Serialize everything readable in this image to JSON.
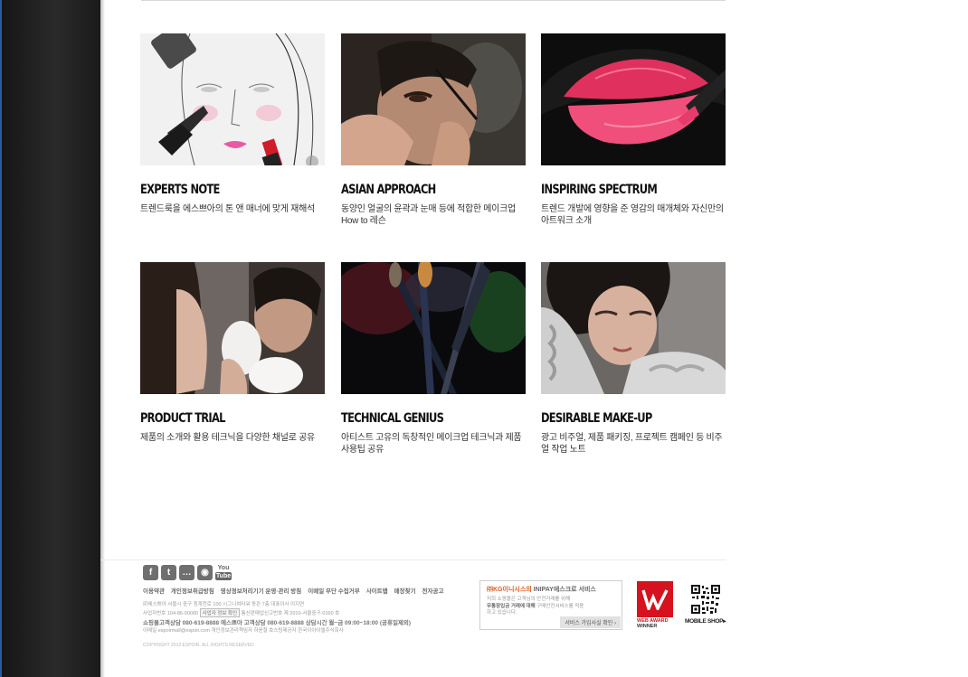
{
  "cards": [
    {
      "title": "EXPERTS NOTE",
      "desc": "트렌드룩을 에스쁘아의 톤 앤 매너에 맞게 재해석"
    },
    {
      "title": "ASIAN APPROACH",
      "desc": "동양인 얼굴의 윤곽과 눈매 등에 적합한 메이크업 How to 레슨"
    },
    {
      "title": "INSPIRING SPECTRUM",
      "desc": "트렌드 개발에 영향을 준 영감의 매개체와 자신만의 아트워크 소개"
    },
    {
      "title": "PRODUCT TRIAL",
      "desc": "제품의 소개와 활용 테크닉을 다양한 채널로 공유"
    },
    {
      "title": "TECHNICAL GENIUS",
      "desc": "아티스트 고유의 독창적인 메이크업 테크닉과 제품 사용팁 공유"
    },
    {
      "title": "DESIRABLE MAKE-UP",
      "desc": "광고 비주얼, 제품 패키징, 프로젝트 캠페인 등 비주얼 작업 노트"
    }
  ],
  "footer": {
    "social": {
      "facebook": "f",
      "twitter": "t",
      "talk": "…",
      "instagram": "◉",
      "youtube_top": "You",
      "youtube_bottom": "Tube"
    },
    "links": [
      "이용약관",
      "개인정보취급방침",
      "영상정보처리기기 운영·관리 방침",
      "이메일 무단 수집거부",
      "사이트맵",
      "매장찾기",
      "전자공고"
    ],
    "info1": "㈜에스쁘아    서울시 중구 청계천로 100 시그니쳐타워 동관 7층    대표이사 이지연",
    "info2a": "사업자번호 104-86-00000",
    "info2_btn": "사업자 정보 확인",
    "info2b": "통신판매업신고번호 제 2010-서울중구-0160 호",
    "info3": "쇼핑몰고객상담 080-619-8888  에스쁘아 고객상담 080-619-8888  상담시간 월~금 09:00~18:00 (공휴일제외)",
    "info4": "이메일 espoirmall@espoir.com    개인정보관리책임자 하윤철    호스팅제공자 한국이아이엘주식회사",
    "copyright": "COPYRIGHT 2012 ESPOIR. ALL RIGHTS RESERVED",
    "kg_title_red": "㈜KG이니시스의",
    "kg_title_rest": " INIPAY에스크로 서비스",
    "kg_line1": "저희 쇼핑몰은 고객님의 안전거래를 위해",
    "kg_line2_b": "무통장입금 거래에 대해",
    "kg_line2_rest": " 구매안전서비스를 적용",
    "kg_line3": "하고 있습니다.",
    "kg_button": "서비스 가입사실 확인 ›",
    "award_line1": "WEB AWARD",
    "award_line2": "WINNER",
    "mobile_label": "MOBILE SHOP▸"
  },
  "colors": {
    "sidebar": "#202020",
    "award_red": "#d6121f",
    "kg_orange": "#e05a1c"
  }
}
